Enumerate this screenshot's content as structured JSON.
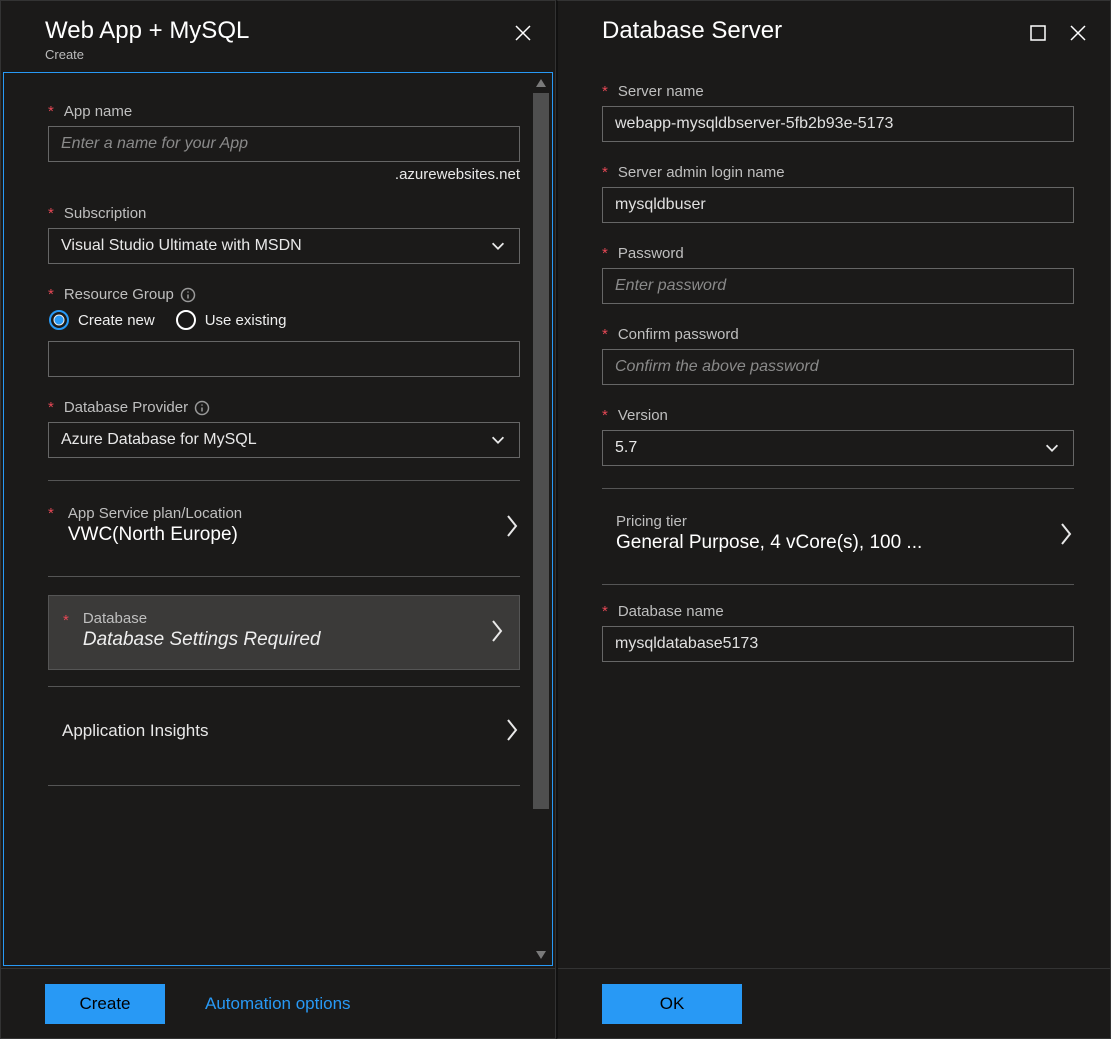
{
  "left": {
    "title": "Web App + MySQL",
    "subtitle": "Create",
    "appName": {
      "label": "App name",
      "placeholder": "Enter a name for your App",
      "suffix": ".azurewebsites.net"
    },
    "subscription": {
      "label": "Subscription",
      "value": "Visual Studio Ultimate with MSDN"
    },
    "resourceGroup": {
      "label": "Resource Group",
      "createNew": "Create new",
      "useExisting": "Use existing",
      "value": ""
    },
    "dbProvider": {
      "label": "Database Provider",
      "value": "Azure Database for MySQL"
    },
    "appService": {
      "label": "App Service plan/Location",
      "value": "VWC(North Europe)"
    },
    "database": {
      "label": "Database",
      "value": "Database Settings Required"
    },
    "appInsights": {
      "label": "Application Insights"
    },
    "footer": {
      "create": "Create",
      "automation": "Automation options"
    }
  },
  "right": {
    "title": "Database Server",
    "serverName": {
      "label": "Server name",
      "value": "webapp-mysqldbserver-5fb2b93e-5173"
    },
    "adminLogin": {
      "label": "Server admin login name",
      "value": "mysqldbuser"
    },
    "password": {
      "label": "Password",
      "placeholder": "Enter password"
    },
    "confirm": {
      "label": "Confirm password",
      "placeholder": "Confirm the above password"
    },
    "version": {
      "label": "Version",
      "value": "5.7"
    },
    "pricing": {
      "label": "Pricing tier",
      "value": "General Purpose, 4 vCore(s), 100 ..."
    },
    "dbName": {
      "label": "Database name",
      "value": "mysqldatabase5173"
    },
    "footer": {
      "ok": "OK"
    }
  }
}
